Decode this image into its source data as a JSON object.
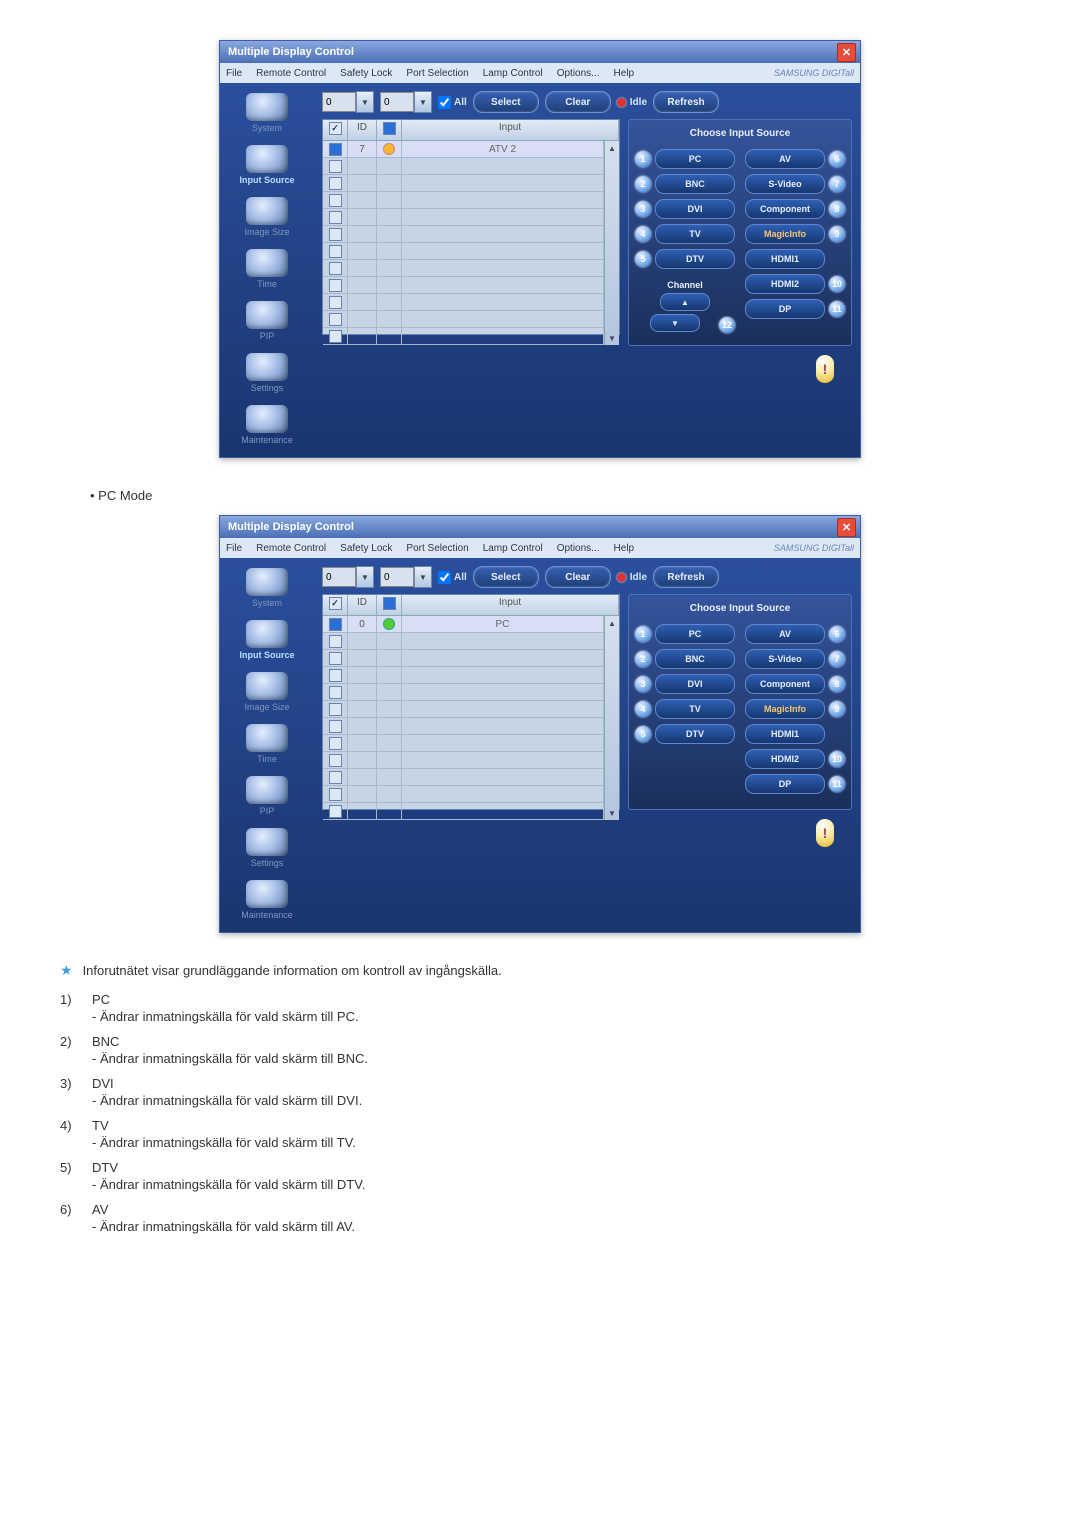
{
  "window": {
    "title": "Multiple Display Control",
    "brand": "SAMSUNG DIGITall"
  },
  "menu": [
    "File",
    "Remote Control",
    "Safety Lock",
    "Port Selection",
    "Lamp Control",
    "Options...",
    "Help"
  ],
  "sidebar": [
    {
      "label": "System"
    },
    {
      "label": "Input Source"
    },
    {
      "label": "Image Size"
    },
    {
      "label": "Time"
    },
    {
      "label": "PIP"
    },
    {
      "label": "Settings"
    },
    {
      "label": "Maintenance"
    }
  ],
  "toolbar": {
    "spin1": "0",
    "spin2": "0",
    "all": "All",
    "select": "Select",
    "clear": "Clear",
    "idle": "Idle",
    "refresh": "Refresh"
  },
  "table": {
    "headers": {
      "c2": "ID",
      "c4": "Input"
    }
  },
  "screenshot1": {
    "row_id": "7",
    "row_input": "ATV 2",
    "panel": {
      "title": "Choose Input Source",
      "left": [
        {
          "num": "1",
          "label": "PC"
        },
        {
          "num": "2",
          "label": "BNC"
        },
        {
          "num": "3",
          "label": "DVI"
        },
        {
          "num": "4",
          "label": "TV"
        },
        {
          "num": "5",
          "label": "DTV"
        }
      ],
      "right": [
        {
          "num": "6",
          "label": "AV"
        },
        {
          "num": "7",
          "label": "S-Video"
        },
        {
          "num": "8",
          "label": "Component"
        },
        {
          "num": "9",
          "label": "MagicInfo"
        },
        {
          "num": "10",
          "label": "HDMI1"
        },
        {
          "num": "",
          "label": "HDMI2"
        },
        {
          "num": "11",
          "label": "DP"
        }
      ],
      "channel_label": "Channel",
      "channel_num": "12"
    }
  },
  "section_label": "• PC Mode",
  "screenshot2": {
    "row_id": "0",
    "row_input": "PC",
    "panel": {
      "title": "Choose Input Source",
      "left": [
        {
          "num": "1",
          "label": "PC"
        },
        {
          "num": "2",
          "label": "BNC"
        },
        {
          "num": "3",
          "label": "DVI"
        },
        {
          "num": "4",
          "label": "TV"
        },
        {
          "num": "5",
          "label": "DTV"
        }
      ],
      "right": [
        {
          "num": "6",
          "label": "AV"
        },
        {
          "num": "7",
          "label": "S-Video"
        },
        {
          "num": "8",
          "label": "Component"
        },
        {
          "num": "9",
          "label": "MagicInfo"
        },
        {
          "num": "10",
          "label": "HDMI1"
        },
        {
          "num": "",
          "label": "HDMI2"
        },
        {
          "num": "11",
          "label": "DP"
        }
      ]
    }
  },
  "note": "Inforutnätet visar grundläggande information om kontroll av ingångskälla.",
  "explanations": [
    {
      "n": "1)",
      "title": "PC",
      "desc": "- Ändrar inmatningskälla för vald skärm till PC."
    },
    {
      "n": "2)",
      "title": "BNC",
      "desc": "- Ändrar inmatningskälla för vald skärm till BNC."
    },
    {
      "n": "3)",
      "title": "DVI",
      "desc": "- Ändrar inmatningskälla för vald skärm till DVI."
    },
    {
      "n": "4)",
      "title": "TV",
      "desc": "- Ändrar inmatningskälla för vald skärm till TV."
    },
    {
      "n": "5)",
      "title": "DTV",
      "desc": "- Ändrar inmatningskälla för vald skärm till DTV."
    },
    {
      "n": "6)",
      "title": "AV",
      "desc": "- Ändrar inmatningskälla för vald skärm till AV."
    }
  ]
}
